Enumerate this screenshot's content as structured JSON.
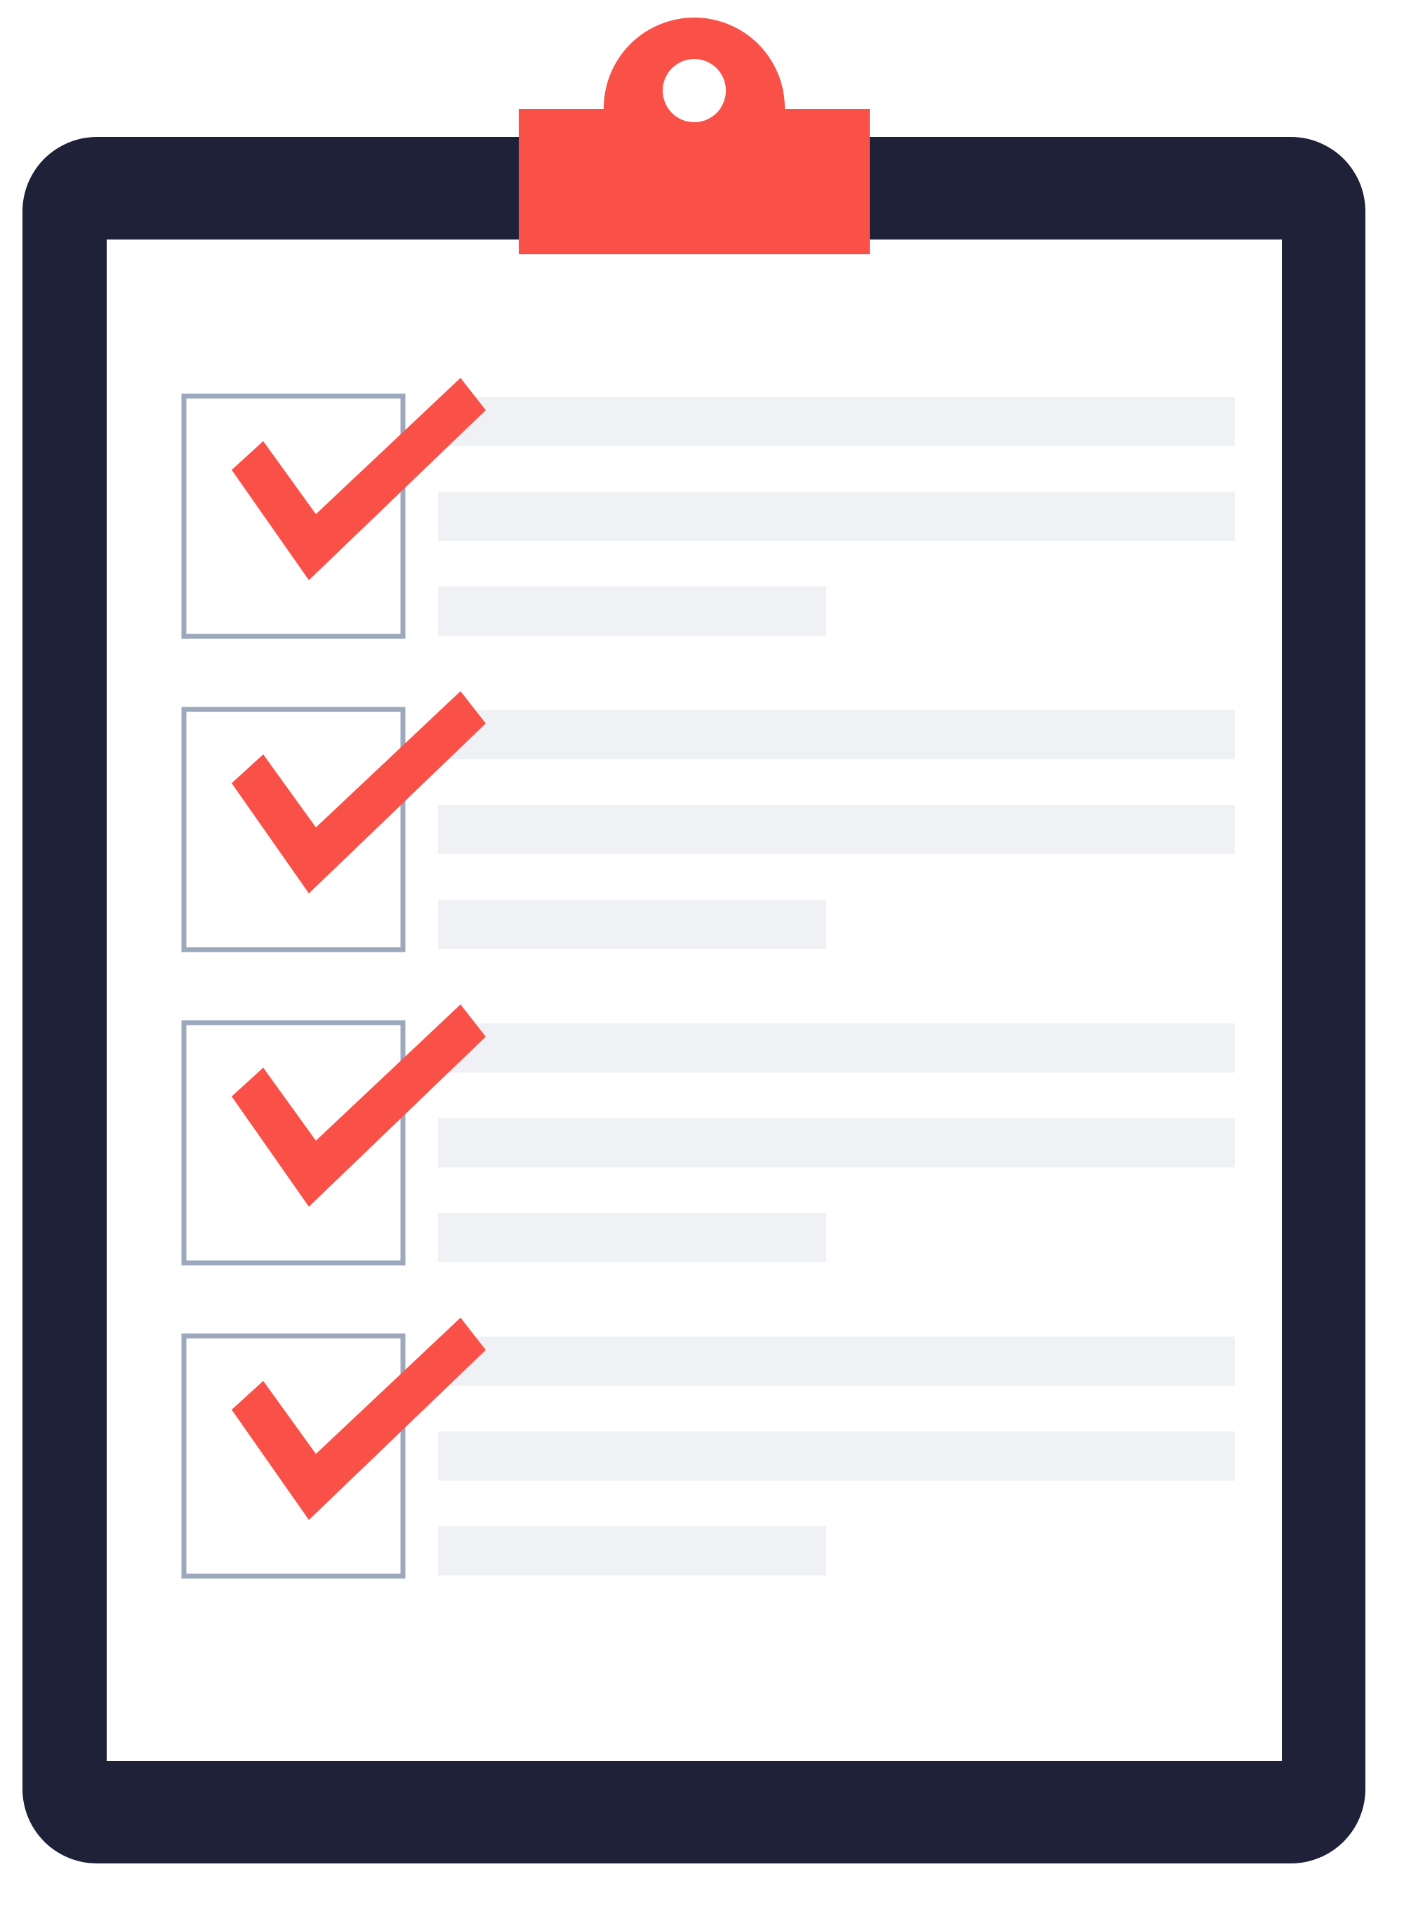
{
  "colors": {
    "board": "#1e2137",
    "paper": "#ffffff",
    "clip": "#f95148",
    "checkmark": "#f95148",
    "checkbox_border": "#9ca8bc",
    "text_placeholder": "#f0f1f5",
    "background": "#ffffff"
  },
  "icons": {
    "board": "clipboard-board-icon",
    "clip": "clipboard-clip-icon",
    "check": "checkmark-icon"
  },
  "checklist": {
    "items": [
      {
        "checked": true,
        "placeholder_lines": 3
      },
      {
        "checked": true,
        "placeholder_lines": 3
      },
      {
        "checked": true,
        "placeholder_lines": 3
      },
      {
        "checked": true,
        "placeholder_lines": 3
      }
    ]
  }
}
